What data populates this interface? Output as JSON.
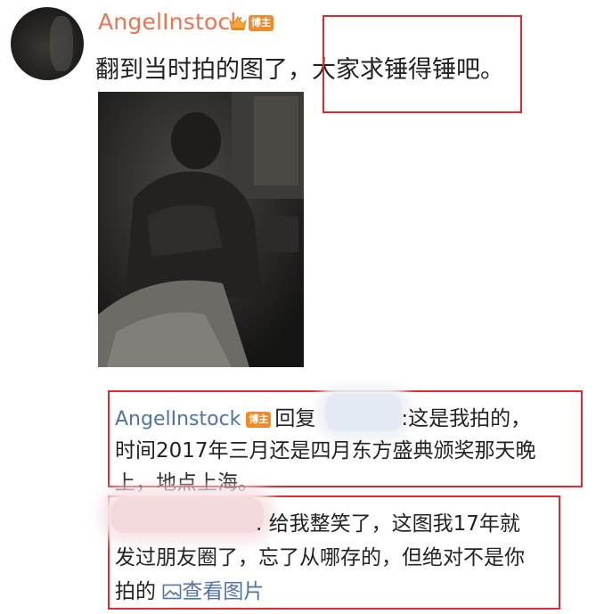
{
  "post": {
    "username": "AngelInstock",
    "badge": "博主",
    "text_plain": "翻到当时拍的图了，",
    "text_highlight": "大家求锤得锤吧。"
  },
  "reply": {
    "username": "AngelInstock",
    "badge": "博主",
    "prefix": "回复",
    "line1_rest": ":这是我拍的，",
    "line2": "时间2017年三月还是四月东方盛典颁奖那天晚",
    "line3": "上，地点上海。"
  },
  "reply2": {
    "line1": ". 给我整笑了，这图我17年就",
    "line2": "发过朋友圈了，忘了从哪存的，但绝对不是你",
    "line3_prefix": "拍的",
    "view_image": "查看图片"
  },
  "colors": {
    "username": "#eb7350",
    "link": "#5173a8",
    "badge": "#f08a2a",
    "highlight_box": "#e02a30"
  },
  "icons": {
    "crown": "crown-icon",
    "image": "image-icon"
  }
}
